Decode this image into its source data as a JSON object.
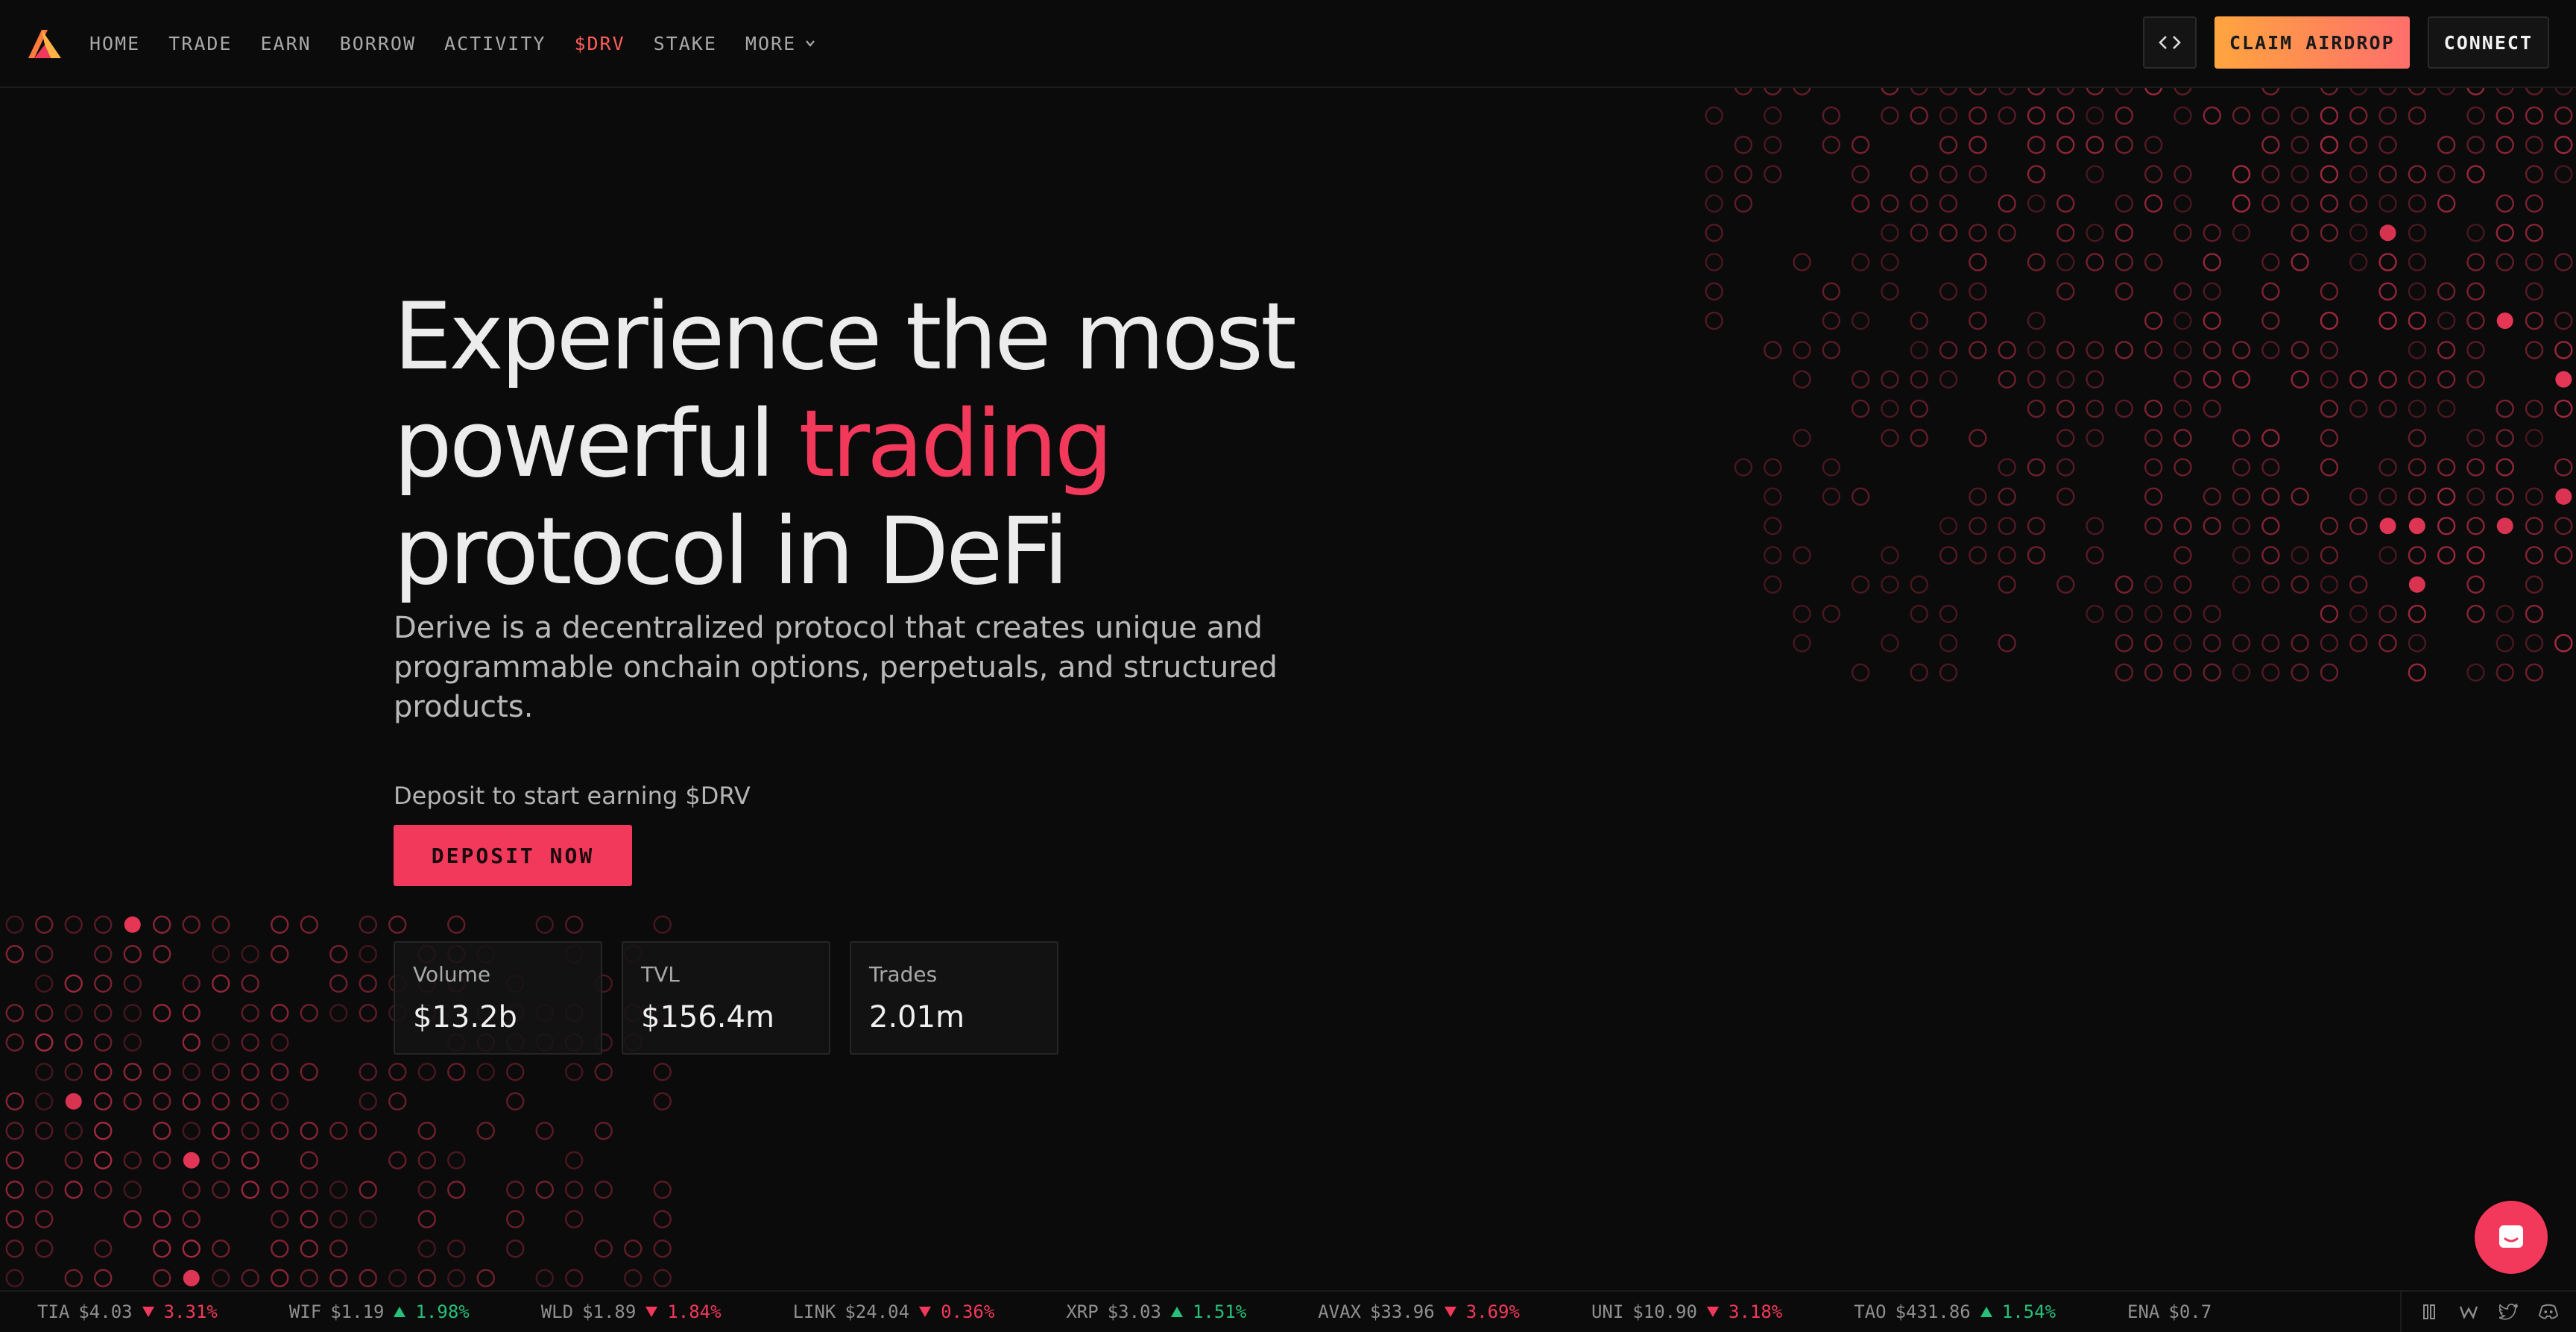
{
  "nav": {
    "links": [
      "HOME",
      "TRADE",
      "EARN",
      "BORROW",
      "ACTIVITY",
      "$DRV",
      "STAKE",
      "MORE"
    ],
    "claim_airdrop": "CLAIM AIRDROP",
    "connect": "CONNECT"
  },
  "hero": {
    "headline_line1": "Experience the most",
    "headline_line2_a": "powerful ",
    "headline_line2_b": "trading",
    "headline_line3": "protocol in DeFi",
    "description": "Derive is a decentralized protocol that creates unique and programmable onchain options, perpetuals, and structured products.",
    "deposit_label": "Deposit to start earning $DRV",
    "deposit_button": "DEPOSIT NOW"
  },
  "stats": [
    {
      "label": "Volume",
      "value": "$13.2b"
    },
    {
      "label": "TVL",
      "value": "$156.4m"
    },
    {
      "label": "Trades",
      "value": "2.01m"
    }
  ],
  "ticker": [
    {
      "symbol": "TIA",
      "price": "$4.03",
      "direction": "down",
      "change": "3.31%"
    },
    {
      "symbol": "WIF",
      "price": "$1.19",
      "direction": "up",
      "change": "1.98%"
    },
    {
      "symbol": "WLD",
      "price": "$1.89",
      "direction": "down",
      "change": "1.84%"
    },
    {
      "symbol": "LINK",
      "price": "$24.04",
      "direction": "down",
      "change": "0.36%"
    },
    {
      "symbol": "XRP",
      "price": "$3.03",
      "direction": "up",
      "change": "1.51%"
    },
    {
      "symbol": "AVAX",
      "price": "$33.96",
      "direction": "down",
      "change": "3.69%"
    },
    {
      "symbol": "UNI",
      "price": "$10.90",
      "direction": "down",
      "change": "3.18%"
    },
    {
      "symbol": "TAO",
      "price": "$431.86",
      "direction": "up",
      "change": "1.54%"
    },
    {
      "symbol": "ENA",
      "price": "$0.7",
      "direction": "",
      "change": ""
    }
  ],
  "social_icons": [
    "mirror-icon",
    "w-icon",
    "twitter-icon",
    "discord-icon"
  ],
  "colors": {
    "accent": "#f2395b",
    "up": "#26c07a",
    "airdrop_start": "#ffa53f",
    "airdrop_end": "#ff6f6b"
  }
}
